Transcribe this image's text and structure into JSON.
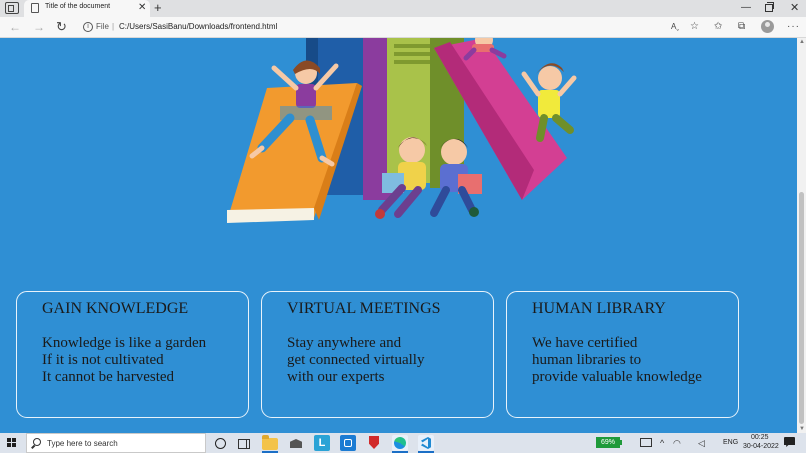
{
  "browser": {
    "tab_title": "Title of the document",
    "new_tab_glyph": "+",
    "close_glyph": "✕",
    "scheme_label": "File",
    "separator": "|",
    "url": "C:/Users/SasiBanu/Downloads/frontend.html",
    "read_aloud_label": "Aˬ",
    "icons": [
      "tab-actions-icon",
      "document-icon",
      "back-arrow-icon",
      "forward-arrow-icon",
      "reload-icon",
      "info-icon",
      "read-aloud-icon",
      "add-favorite-icon",
      "favorites-icon",
      "collections-icon",
      "profile-icon",
      "more-icon"
    ]
  },
  "page": {
    "background": "#2f8fd4",
    "cards": [
      {
        "title": "GAIN KNOWLEDGE",
        "lines": [
          "Knowledge is like a garden",
          "If it is not cultivated",
          "It cannot be harvested"
        ]
      },
      {
        "title": "VIRTUAL MEETINGS",
        "lines": [
          "Stay anywhere and",
          "get connected virtually",
          "with our experts"
        ]
      },
      {
        "title": "HUMAN LIBRARY",
        "lines": [
          "We have certified",
          "human libraries to",
          "provide valuable knowledge"
        ]
      }
    ]
  },
  "taskbar": {
    "search_placeholder": "Type here to search",
    "app_l_label": "L",
    "battery": "69%",
    "language": "ENG",
    "time": "00:25",
    "date": "30-04-2022"
  }
}
